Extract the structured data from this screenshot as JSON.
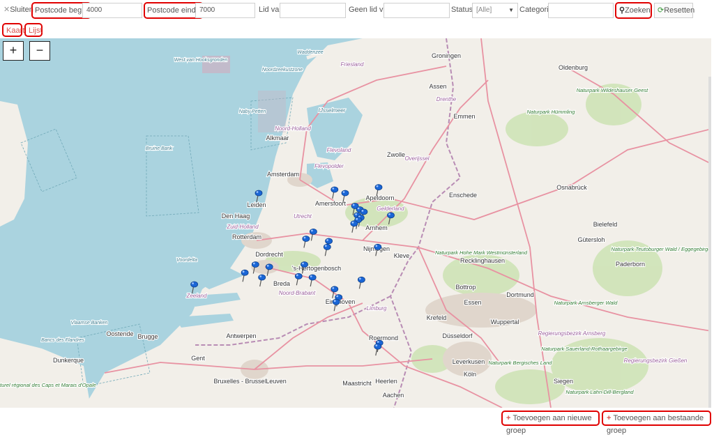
{
  "toolbar": {
    "close_label": "Sluiten",
    "postcode_begin_label": "Postcode begin",
    "postcode_begin_value": "4000",
    "postcode_end_label": "Postcode einde",
    "postcode_end_value": "7000",
    "member_of_label": "Lid van",
    "member_of_value": "",
    "not_member_of_label": "Geen lid van",
    "not_member_of_value": "",
    "status_label": "Status",
    "status_value": "[Alle]",
    "category_label": "Categorie",
    "category_value": "",
    "search_label": "Zoeken",
    "reset_label": "Resetten"
  },
  "tabs": [
    {
      "label": "Kaart",
      "active": true
    },
    {
      "label": "Lijst",
      "active": false
    }
  ],
  "zoom": {
    "in": "+",
    "out": "−"
  },
  "map": {
    "places": [
      {
        "name": "Waddenzee",
        "kind": "sea"
      },
      {
        "name": "Groningen",
        "kind": "city"
      },
      {
        "name": "Oldenburg",
        "kind": "city"
      },
      {
        "name": "Friesland",
        "kind": "region"
      },
      {
        "name": "Assen",
        "kind": "city"
      },
      {
        "name": "Drenthe",
        "kind": "region"
      },
      {
        "name": "Emmen",
        "kind": "city"
      },
      {
        "name": "Naturpark Wildeshauser Geest",
        "kind": "park"
      },
      {
        "name": "Naturpark Hümmling",
        "kind": "park"
      },
      {
        "name": "West van Hooksgronden",
        "kind": "sea"
      },
      {
        "name": "Noordzeekustzone",
        "kind": "sea"
      },
      {
        "name": "IJsselmeer",
        "kind": "water"
      },
      {
        "name": "Naby Petten",
        "kind": "sea"
      },
      {
        "name": "Noord-Holland",
        "kind": "region"
      },
      {
        "name": "Alkmaar",
        "kind": "city"
      },
      {
        "name": "Flevoland",
        "kind": "region"
      },
      {
        "name": "Flevopolder",
        "kind": "region"
      },
      {
        "name": "Overijssel",
        "kind": "region"
      },
      {
        "name": "Zwolle",
        "kind": "city"
      },
      {
        "name": "Bruine Bank",
        "kind": "sea"
      },
      {
        "name": "Amsterdam",
        "kind": "city"
      },
      {
        "name": "Amersfoort",
        "kind": "city"
      },
      {
        "name": "Apeldoorn",
        "kind": "city"
      },
      {
        "name": "Enschede",
        "kind": "city"
      },
      {
        "name": "Osnabrück",
        "kind": "city"
      },
      {
        "name": "Leiden",
        "kind": "city"
      },
      {
        "name": "Den Haag",
        "kind": "city"
      },
      {
        "name": "Zuid-Holland",
        "kind": "region"
      },
      {
        "name": "Utrecht",
        "kind": "region"
      },
      {
        "name": "Gelderland",
        "kind": "region"
      },
      {
        "name": "Arnhem",
        "kind": "city"
      },
      {
        "name": "Rotterdam",
        "kind": "city"
      },
      {
        "name": "Nijmegen",
        "kind": "city"
      },
      {
        "name": "Bielefeld",
        "kind": "city"
      },
      {
        "name": "Gütersloh",
        "kind": "city"
      },
      {
        "name": "Dordrecht",
        "kind": "city"
      },
      {
        "name": "'s-Hertogenbosch",
        "kind": "city"
      },
      {
        "name": "Kleve",
        "kind": "city"
      },
      {
        "name": "Naturpark Hohe Mark Westmünsterland",
        "kind": "park"
      },
      {
        "name": "Naturpark Teutoburger Wald / Eggegebirge",
        "kind": "park"
      },
      {
        "name": "Voordelta",
        "kind": "sea"
      },
      {
        "name": "Breda",
        "kind": "city"
      },
      {
        "name": "Noord-Brabant",
        "kind": "region"
      },
      {
        "name": "Recklinghausen",
        "kind": "city"
      },
      {
        "name": "Bottrop",
        "kind": "city"
      },
      {
        "name": "Zeeland",
        "kind": "region"
      },
      {
        "name": "Eindhoven",
        "kind": "city"
      },
      {
        "name": "Essen",
        "kind": "city"
      },
      {
        "name": "Dortmund",
        "kind": "city"
      },
      {
        "name": "Paderborn",
        "kind": "city"
      },
      {
        "name": "Naturpark Arnsberger Wald",
        "kind": "park"
      },
      {
        "name": "Vlaamse Banken",
        "kind": "sea"
      },
      {
        "name": "Limburg",
        "kind": "region"
      },
      {
        "name": "Krefeld",
        "kind": "city"
      },
      {
        "name": "Wuppertal",
        "kind": "city"
      },
      {
        "name": "Oostende",
        "kind": "city"
      },
      {
        "name": "Brugge",
        "kind": "city"
      },
      {
        "name": "Bancs des Flandres",
        "kind": "sea"
      },
      {
        "name": "Antwerpen",
        "kind": "city"
      },
      {
        "name": "Roermond",
        "kind": "city"
      },
      {
        "name": "Düsseldorf",
        "kind": "city"
      },
      {
        "name": "Gent",
        "kind": "city"
      },
      {
        "name": "Dunkerque",
        "kind": "city"
      },
      {
        "name": "Naturpark Sauerland-Rothaargebirge",
        "kind": "park"
      },
      {
        "name": "Regierungsbezirk Arnsberg",
        "kind": "region"
      },
      {
        "name": "Leverkusen",
        "kind": "city"
      },
      {
        "name": "Naturpark Bergisches Land",
        "kind": "park"
      },
      {
        "name": "Bruxelles - Brussel",
        "kind": "city"
      },
      {
        "name": "Leuven",
        "kind": "city"
      },
      {
        "name": "Maastricht",
        "kind": "city"
      },
      {
        "name": "Heerlen",
        "kind": "city"
      },
      {
        "name": "Köln",
        "kind": "city"
      },
      {
        "name": "Aachen",
        "kind": "city"
      },
      {
        "name": "Siegen",
        "kind": "city"
      },
      {
        "name": "Parc naturel régional des Caps et Marais d'Opale",
        "kind": "park"
      },
      {
        "name": "Regierungsbezirk Gießen",
        "kind": "region"
      },
      {
        "name": "Naturpark Lahn-Dill-Bergland",
        "kind": "park"
      }
    ],
    "pins": [
      {
        "lat": 52.16,
        "lon": 4.49
      },
      {
        "lat": 52.19,
        "lon": 5.42
      },
      {
        "lat": 52.16,
        "lon": 5.55
      },
      {
        "lat": 52.21,
        "lon": 5.96
      },
      {
        "lat": 52.05,
        "lon": 5.67
      },
      {
        "lat": 52.02,
        "lon": 5.73
      },
      {
        "lat": 52.0,
        "lon": 5.78
      },
      {
        "lat": 51.97,
        "lon": 5.7
      },
      {
        "lat": 51.95,
        "lon": 5.74
      },
      {
        "lat": 51.93,
        "lon": 5.71
      },
      {
        "lat": 51.9,
        "lon": 5.66
      },
      {
        "lat": 51.97,
        "lon": 6.11
      },
      {
        "lat": 51.83,
        "lon": 5.16
      },
      {
        "lat": 51.77,
        "lon": 5.07
      },
      {
        "lat": 51.75,
        "lon": 5.35
      },
      {
        "lat": 51.7,
        "lon": 5.33
      },
      {
        "lat": 51.7,
        "lon": 5.95
      },
      {
        "lat": 51.55,
        "lon": 4.45
      },
      {
        "lat": 51.53,
        "lon": 4.62
      },
      {
        "lat": 51.48,
        "lon": 4.32
      },
      {
        "lat": 51.44,
        "lon": 4.53
      },
      {
        "lat": 51.55,
        "lon": 5.05
      },
      {
        "lat": 51.45,
        "lon": 4.98
      },
      {
        "lat": 51.44,
        "lon": 5.15
      },
      {
        "lat": 51.42,
        "lon": 5.75
      },
      {
        "lat": 51.38,
        "lon": 3.7
      },
      {
        "lat": 51.34,
        "lon": 5.42
      },
      {
        "lat": 51.27,
        "lon": 5.47
      },
      {
        "lat": 51.23,
        "lon": 5.44
      },
      {
        "lat": 50.88,
        "lon": 5.97
      },
      {
        "lat": 50.85,
        "lon": 5.95
      }
    ]
  },
  "footer": {
    "add_new_group_label": "Toevoegen aan nieuwe groep",
    "add_existing_group_label": "Toevoegen aan bestaande groep"
  },
  "colors": {
    "highlight": "#e00000",
    "sea": "#aad3df",
    "land": "#f2efe9",
    "pin": "#1a66d6",
    "motorway": "#e892a2"
  }
}
